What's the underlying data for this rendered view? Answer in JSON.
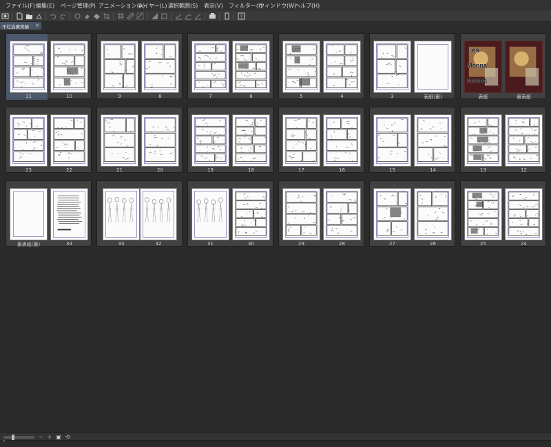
{
  "menu": [
    "ファイル(F)",
    "編集(E)",
    "ページ管理(P)",
    "アニメーション(A)",
    "レイヤー(L)",
    "選択範囲(S)",
    "表示(V)",
    "フィルター(I)",
    "ウィンドウ(W)",
    "ヘルプ(H)"
  ],
  "toolbar_icons": [
    "app-icon",
    "new-file-icon",
    "open-file-icon",
    "save-icon",
    "undo-icon",
    "redo-icon",
    "clear-icon",
    "fill-icon",
    "transform-icon",
    "crop-icon",
    "grid-icon",
    "ruler-icon",
    "snap-icon",
    "invert-icon",
    "border-icon",
    "line-snap-icon",
    "curve-snap-icon",
    "angle-snap-icon",
    "preview-icon",
    "device-icon",
    "help-icon"
  ],
  "document_tab": {
    "title": "不社治療実験",
    "close": "×"
  },
  "colors": {
    "accent_selection": "#52607a",
    "frame_guide": "#9a97cf",
    "page": "#fbfbfb",
    "background": "#2b2b2b"
  },
  "rows": [
    [
      {
        "pages": [
          {
            "label": "11",
            "kind": "manga",
            "selected": true
          },
          {
            "label": "10",
            "kind": "dark"
          }
        ]
      },
      {
        "pages": [
          {
            "label": "9",
            "kind": "manga"
          },
          {
            "label": "8",
            "kind": "manga"
          }
        ]
      },
      {
        "pages": [
          {
            "label": "7",
            "kind": "manga"
          },
          {
            "label": "6",
            "kind": "dark"
          }
        ]
      },
      {
        "pages": [
          {
            "label": "5",
            "kind": "dark"
          },
          {
            "label": "4",
            "kind": "manga"
          }
        ]
      },
      {
        "pages": [
          {
            "label": "3",
            "kind": "manga"
          },
          {
            "label": "表紙(裏)",
            "kind": "blank"
          }
        ]
      },
      {
        "pages": [
          {
            "label": "表紙",
            "kind": "cover"
          },
          {
            "label": "裏表紙",
            "kind": "cover"
          }
        ]
      }
    ],
    [
      {
        "pages": [
          {
            "label": "23",
            "kind": "manga"
          },
          {
            "label": "22",
            "kind": "manga"
          }
        ]
      },
      {
        "pages": [
          {
            "label": "21",
            "kind": "manga"
          },
          {
            "label": "20",
            "kind": "manga"
          }
        ]
      },
      {
        "pages": [
          {
            "label": "19",
            "kind": "manga"
          },
          {
            "label": "18",
            "kind": "manga"
          }
        ]
      },
      {
        "pages": [
          {
            "label": "17",
            "kind": "manga"
          },
          {
            "label": "16",
            "kind": "manga"
          }
        ]
      },
      {
        "pages": [
          {
            "label": "15",
            "kind": "manga"
          },
          {
            "label": "14",
            "kind": "manga"
          }
        ]
      },
      {
        "pages": [
          {
            "label": "13",
            "kind": "dark"
          },
          {
            "label": "12",
            "kind": "manga"
          }
        ]
      }
    ],
    [
      {
        "pages": [
          {
            "label": "裏表紙(裏)",
            "kind": "blank"
          },
          {
            "label": "34",
            "kind": "text"
          }
        ]
      },
      {
        "wide": true,
        "pages": [
          {
            "label": "33",
            "kind": "sketch"
          },
          {
            "label": "32",
            "kind": "sketch"
          }
        ]
      },
      {
        "pages": [
          {
            "label": "31",
            "kind": "sketch"
          },
          {
            "label": "30",
            "kind": "manga"
          }
        ]
      },
      {
        "pages": [
          {
            "label": "29",
            "kind": "manga"
          },
          {
            "label": "28",
            "kind": "manga"
          }
        ]
      },
      {
        "pages": [
          {
            "label": "27",
            "kind": "dark"
          },
          {
            "label": "26",
            "kind": "manga"
          }
        ]
      },
      {
        "pages": [
          {
            "label": "25",
            "kind": "dark"
          },
          {
            "label": "24",
            "kind": "manga"
          }
        ]
      }
    ]
  ],
  "cover_text": {
    "line1": "Les",
    "line2": "Monna",
    "line3": "Monna"
  },
  "statusbar": {
    "zoom_out": "−",
    "zoom_in": "+"
  }
}
